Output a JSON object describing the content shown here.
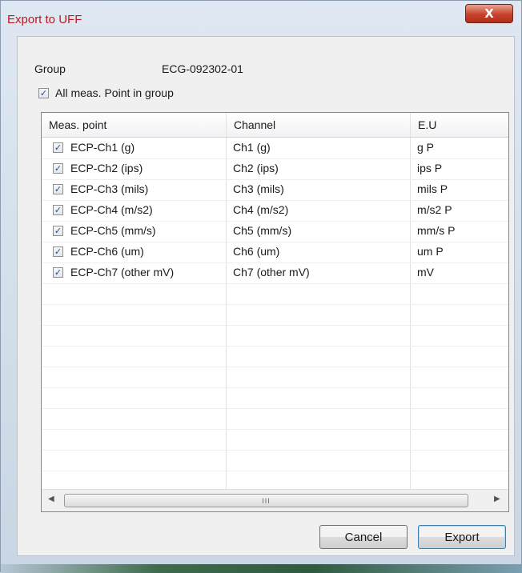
{
  "window": {
    "title": "Export to UFF",
    "close_glyph": "X"
  },
  "form": {
    "group_label": "Group",
    "group_value": "ECG-092302-01",
    "all_points_label": "All meas. Point in group",
    "all_points_checked": true
  },
  "table": {
    "columns": [
      "Meas. point",
      "Channel",
      "E.U"
    ],
    "rows": [
      {
        "checked": true,
        "point": "ECP-Ch1 (g)",
        "channel": "Ch1 (g)",
        "eu": "g P"
      },
      {
        "checked": true,
        "point": "ECP-Ch2 (ips)",
        "channel": "Ch2 (ips)",
        "eu": "ips P"
      },
      {
        "checked": true,
        "point": "ECP-Ch3 (mils)",
        "channel": "Ch3 (mils)",
        "eu": "mils P"
      },
      {
        "checked": true,
        "point": "ECP-Ch4 (m/s2)",
        "channel": "Ch4 (m/s2)",
        "eu": "m/s2 P"
      },
      {
        "checked": true,
        "point": "ECP-Ch5 (mm/s)",
        "channel": "Ch5 (mm/s)",
        "eu": "mm/s P"
      },
      {
        "checked": true,
        "point": "ECP-Ch6 (um)",
        "channel": "Ch6 (um)",
        "eu": "um P"
      },
      {
        "checked": true,
        "point": "ECP-Ch7 (other mV)",
        "channel": "Ch7 (other mV)",
        "eu": "mV"
      }
    ]
  },
  "scrollbar": {
    "left_arrow": "◀",
    "right_arrow": "▶",
    "grip": "III"
  },
  "buttons": {
    "cancel": "Cancel",
    "export": "Export"
  },
  "icons": {
    "close": "close-icon",
    "check": "checkmark-icon"
  },
  "colors": {
    "title": "#c4161c",
    "close_button": "#c7422b",
    "check": "#2c4a85"
  }
}
